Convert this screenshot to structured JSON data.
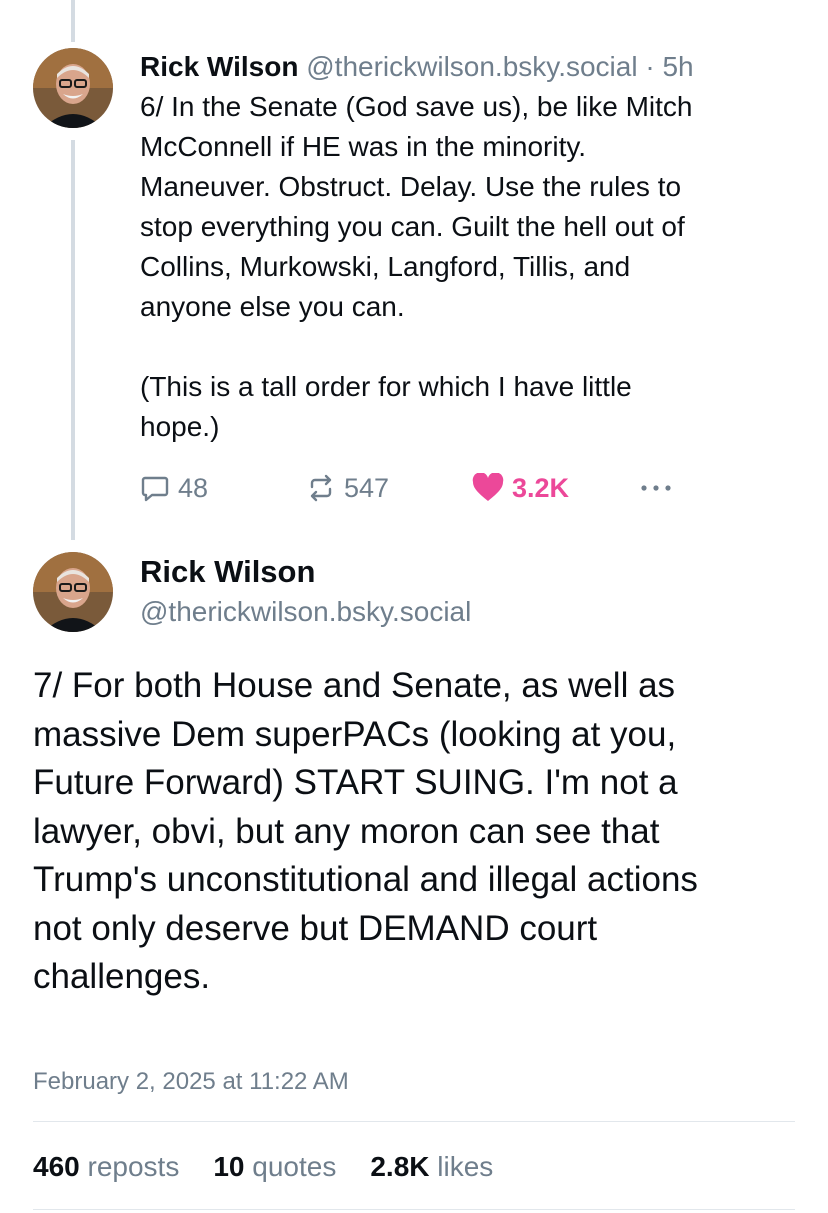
{
  "post6": {
    "author_name": "Rick Wilson",
    "handle": "@therickwilson.bsky.social",
    "separator": "·",
    "time_ago": "5h",
    "text": "6/ In the Senate (God save us), be like Mitch\nMcConnell if HE was in the minority.\nManeuver. Obstruct. Delay. Use the rules to\nstop everything you can. Guilt the hell out of\nCollins, Murkowski, Langford, Tillis, and\nanyone else you can.\n\n(This is a tall order for which I have little\nhope.)",
    "reply_count": "48",
    "repost_count": "547",
    "like_count": "3.2K",
    "like_color": "#ec4899",
    "icons": {
      "reply": "reply-bubble-icon",
      "repost": "repost-icon",
      "like": "heart-icon",
      "more": "more-dots-icon"
    }
  },
  "post7": {
    "author_name": "Rick Wilson",
    "handle": "@therickwilson.bsky.social",
    "text": "7/ For both House and Senate, as well as\nmassive Dem superPACs (looking at you,\nFuture Forward) START SUING. I'm not a\nlawyer, obvi, but any moron can see that\nTrump's unconstitutional and illegal actions\nnot only deserve but DEMAND court\nchallenges.",
    "timestamp": "February 2, 2025 at 11:22 AM",
    "stats": {
      "reposts_num": "460",
      "reposts_label": "reposts",
      "quotes_num": "10",
      "quotes_label": "quotes",
      "likes_num": "2.8K",
      "likes_label": "likes"
    }
  },
  "colors": {
    "muted_text": "#6f7e8c",
    "thread_line": "#d4dbe2",
    "divider": "#e2e7ec"
  }
}
